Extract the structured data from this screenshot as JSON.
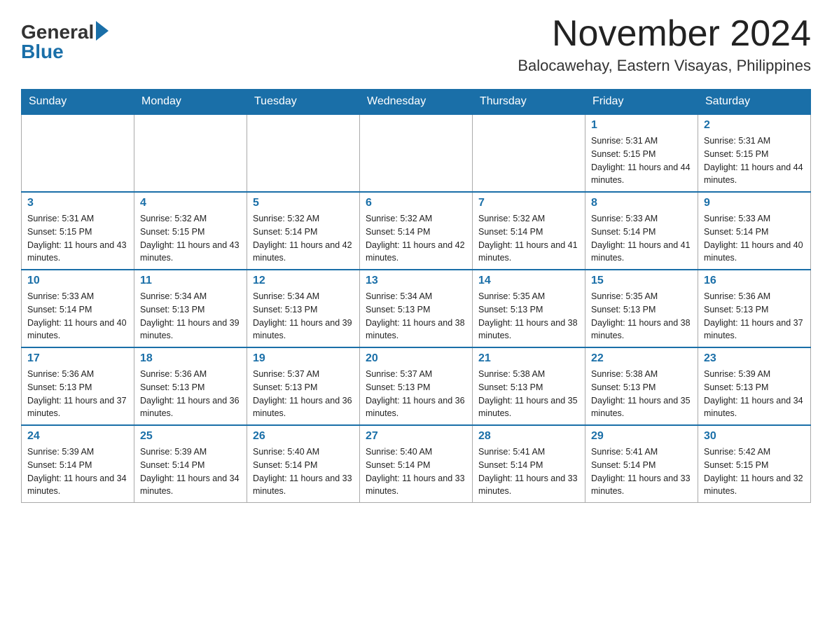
{
  "header": {
    "logo_general": "General",
    "logo_blue": "Blue",
    "month_title": "November 2024",
    "location": "Balocawehay, Eastern Visayas, Philippines"
  },
  "weekdays": [
    "Sunday",
    "Monday",
    "Tuesday",
    "Wednesday",
    "Thursday",
    "Friday",
    "Saturday"
  ],
  "weeks": [
    [
      {
        "day": "",
        "info": ""
      },
      {
        "day": "",
        "info": ""
      },
      {
        "day": "",
        "info": ""
      },
      {
        "day": "",
        "info": ""
      },
      {
        "day": "",
        "info": ""
      },
      {
        "day": "1",
        "info": "Sunrise: 5:31 AM\nSunset: 5:15 PM\nDaylight: 11 hours and 44 minutes."
      },
      {
        "day": "2",
        "info": "Sunrise: 5:31 AM\nSunset: 5:15 PM\nDaylight: 11 hours and 44 minutes."
      }
    ],
    [
      {
        "day": "3",
        "info": "Sunrise: 5:31 AM\nSunset: 5:15 PM\nDaylight: 11 hours and 43 minutes."
      },
      {
        "day": "4",
        "info": "Sunrise: 5:32 AM\nSunset: 5:15 PM\nDaylight: 11 hours and 43 minutes."
      },
      {
        "day": "5",
        "info": "Sunrise: 5:32 AM\nSunset: 5:14 PM\nDaylight: 11 hours and 42 minutes."
      },
      {
        "day": "6",
        "info": "Sunrise: 5:32 AM\nSunset: 5:14 PM\nDaylight: 11 hours and 42 minutes."
      },
      {
        "day": "7",
        "info": "Sunrise: 5:32 AM\nSunset: 5:14 PM\nDaylight: 11 hours and 41 minutes."
      },
      {
        "day": "8",
        "info": "Sunrise: 5:33 AM\nSunset: 5:14 PM\nDaylight: 11 hours and 41 minutes."
      },
      {
        "day": "9",
        "info": "Sunrise: 5:33 AM\nSunset: 5:14 PM\nDaylight: 11 hours and 40 minutes."
      }
    ],
    [
      {
        "day": "10",
        "info": "Sunrise: 5:33 AM\nSunset: 5:14 PM\nDaylight: 11 hours and 40 minutes."
      },
      {
        "day": "11",
        "info": "Sunrise: 5:34 AM\nSunset: 5:13 PM\nDaylight: 11 hours and 39 minutes."
      },
      {
        "day": "12",
        "info": "Sunrise: 5:34 AM\nSunset: 5:13 PM\nDaylight: 11 hours and 39 minutes."
      },
      {
        "day": "13",
        "info": "Sunrise: 5:34 AM\nSunset: 5:13 PM\nDaylight: 11 hours and 38 minutes."
      },
      {
        "day": "14",
        "info": "Sunrise: 5:35 AM\nSunset: 5:13 PM\nDaylight: 11 hours and 38 minutes."
      },
      {
        "day": "15",
        "info": "Sunrise: 5:35 AM\nSunset: 5:13 PM\nDaylight: 11 hours and 38 minutes."
      },
      {
        "day": "16",
        "info": "Sunrise: 5:36 AM\nSunset: 5:13 PM\nDaylight: 11 hours and 37 minutes."
      }
    ],
    [
      {
        "day": "17",
        "info": "Sunrise: 5:36 AM\nSunset: 5:13 PM\nDaylight: 11 hours and 37 minutes."
      },
      {
        "day": "18",
        "info": "Sunrise: 5:36 AM\nSunset: 5:13 PM\nDaylight: 11 hours and 36 minutes."
      },
      {
        "day": "19",
        "info": "Sunrise: 5:37 AM\nSunset: 5:13 PM\nDaylight: 11 hours and 36 minutes."
      },
      {
        "day": "20",
        "info": "Sunrise: 5:37 AM\nSunset: 5:13 PM\nDaylight: 11 hours and 36 minutes."
      },
      {
        "day": "21",
        "info": "Sunrise: 5:38 AM\nSunset: 5:13 PM\nDaylight: 11 hours and 35 minutes."
      },
      {
        "day": "22",
        "info": "Sunrise: 5:38 AM\nSunset: 5:13 PM\nDaylight: 11 hours and 35 minutes."
      },
      {
        "day": "23",
        "info": "Sunrise: 5:39 AM\nSunset: 5:13 PM\nDaylight: 11 hours and 34 minutes."
      }
    ],
    [
      {
        "day": "24",
        "info": "Sunrise: 5:39 AM\nSunset: 5:14 PM\nDaylight: 11 hours and 34 minutes."
      },
      {
        "day": "25",
        "info": "Sunrise: 5:39 AM\nSunset: 5:14 PM\nDaylight: 11 hours and 34 minutes."
      },
      {
        "day": "26",
        "info": "Sunrise: 5:40 AM\nSunset: 5:14 PM\nDaylight: 11 hours and 33 minutes."
      },
      {
        "day": "27",
        "info": "Sunrise: 5:40 AM\nSunset: 5:14 PM\nDaylight: 11 hours and 33 minutes."
      },
      {
        "day": "28",
        "info": "Sunrise: 5:41 AM\nSunset: 5:14 PM\nDaylight: 11 hours and 33 minutes."
      },
      {
        "day": "29",
        "info": "Sunrise: 5:41 AM\nSunset: 5:14 PM\nDaylight: 11 hours and 33 minutes."
      },
      {
        "day": "30",
        "info": "Sunrise: 5:42 AM\nSunset: 5:15 PM\nDaylight: 11 hours and 32 minutes."
      }
    ]
  ]
}
